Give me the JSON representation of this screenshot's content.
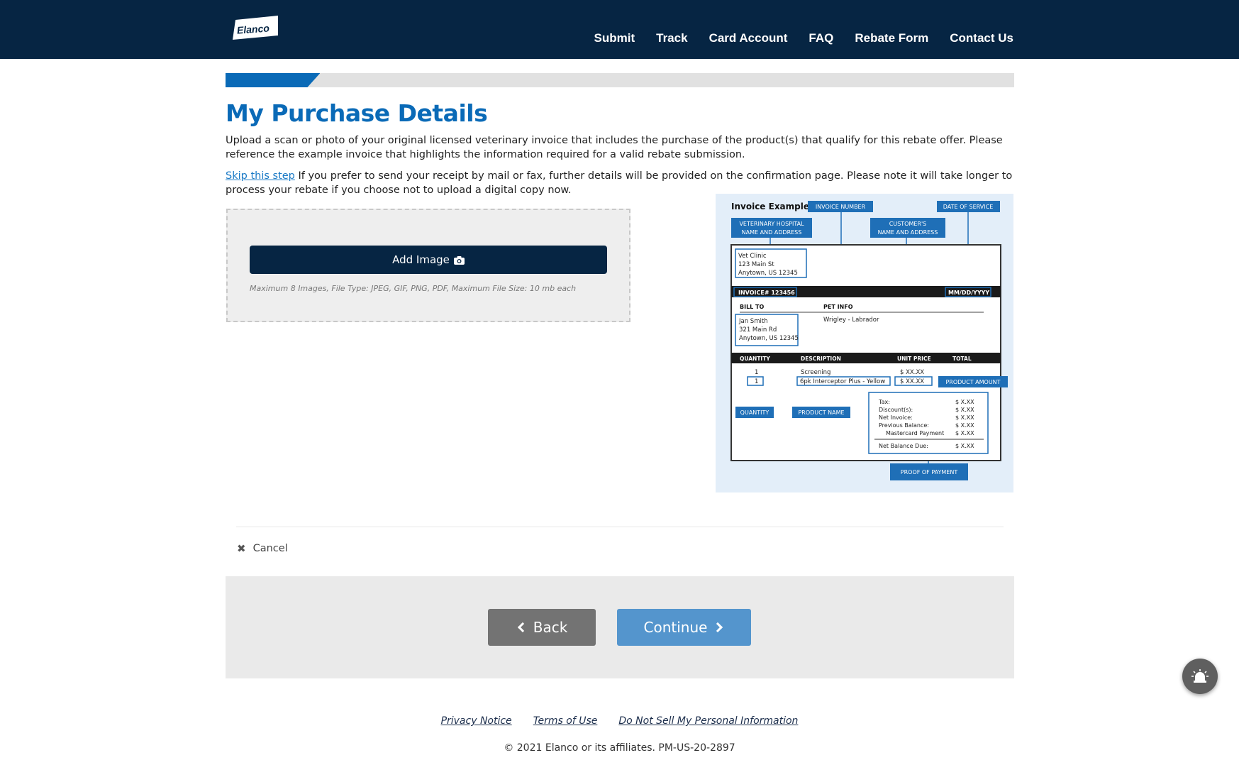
{
  "brand": {
    "logo_text": "Elanco"
  },
  "nav": [
    {
      "label": "Submit"
    },
    {
      "label": "Track"
    },
    {
      "label": "Card Account"
    },
    {
      "label": "FAQ"
    },
    {
      "label": "Rebate Form"
    },
    {
      "label": "Contact Us"
    }
  ],
  "progress": {
    "fraction": 0.12
  },
  "page": {
    "title": "My Purchase Details",
    "intro": "Upload a scan or photo of your original licensed veterinary invoice that includes the purchase of the product(s) that qualify for this rebate offer. Please reference the example invoice that highlights the information required for a valid rebate submission.",
    "skip_link": "Skip this step",
    "skip_text": " If you prefer to send your receipt by mail or fax, further details will be provided on the confirmation page. Please note it will take longer to process your rebate if you choose not to upload a digital copy now."
  },
  "upload": {
    "button_label": "Add Image",
    "note": "Maximum 8 Images, File Type: JPEG, GIF, PNG, PDF, Maximum File Size: 10 mb each"
  },
  "invoice_example": {
    "title": "Invoice Example",
    "callouts": {
      "invoice_number": "INVOICE NUMBER",
      "date_of_service": "DATE OF SERVICE",
      "vet_hospital_1": "VETERINARY HOSPITAL",
      "vet_hospital_2": "NAME AND ADDRESS",
      "customer_1": "CUSTOMER'S",
      "customer_2": "NAME AND ADDRESS",
      "product_amount": "PRODUCT AMOUNT",
      "quantity": "QUANTITY",
      "product_name": "PRODUCT NAME",
      "proof_of_payment": "PROOF OF PAYMENT"
    },
    "clinic": [
      "Vet Clinic",
      "123 Main St",
      "Anytown, US 12345"
    ],
    "invoice_no": "INVOICE# 123456",
    "date": "MM/DD/YYYY",
    "bill_to_label": "BILL TO",
    "pet_info_label": "PET INFO",
    "customer": [
      "Jan Smith",
      "321 Main Rd",
      "Anytown, US 12345"
    ],
    "pet": "Wrigley - Labrador",
    "columns": [
      "QUANTITY",
      "DESCRIPTION",
      "UNIT PRICE",
      "TOTAL"
    ],
    "rows": [
      {
        "qty": "1",
        "desc": "Screening",
        "price": "$  XX.XX"
      },
      {
        "qty": "1",
        "desc": "6pk Interceptor Plus - Yellow",
        "price": "$  XX.XX"
      }
    ],
    "totals": [
      {
        "label": "Tax:",
        "value": "$  X.XX"
      },
      {
        "label": "Discount(s):",
        "value": "$  X.XX"
      },
      {
        "label": "Net Invoice:",
        "value": "$  X.XX"
      },
      {
        "label": "Previous Balance:",
        "value": "$  X.XX"
      },
      {
        "label": "Mastercard Payment",
        "value": "$  X.XX"
      }
    ],
    "net_balance": {
      "label": "Net Balance Due:",
      "value": "$  X.XX"
    }
  },
  "actions": {
    "cancel": "Cancel",
    "back": "Back",
    "continue": "Continue"
  },
  "footer": {
    "links": [
      "Privacy Notice",
      "Terms of Use",
      "Do Not Sell My Personal Information"
    ],
    "copyright": "© 2021 Elanco or its affiliates. PM-US-20-2897"
  },
  "colors": {
    "header_bg": "#062543",
    "accent_blue": "#0a6ab7",
    "callout_blue": "#1f6fb7",
    "continue_bg": "#5495cd",
    "back_bg": "#737373"
  }
}
